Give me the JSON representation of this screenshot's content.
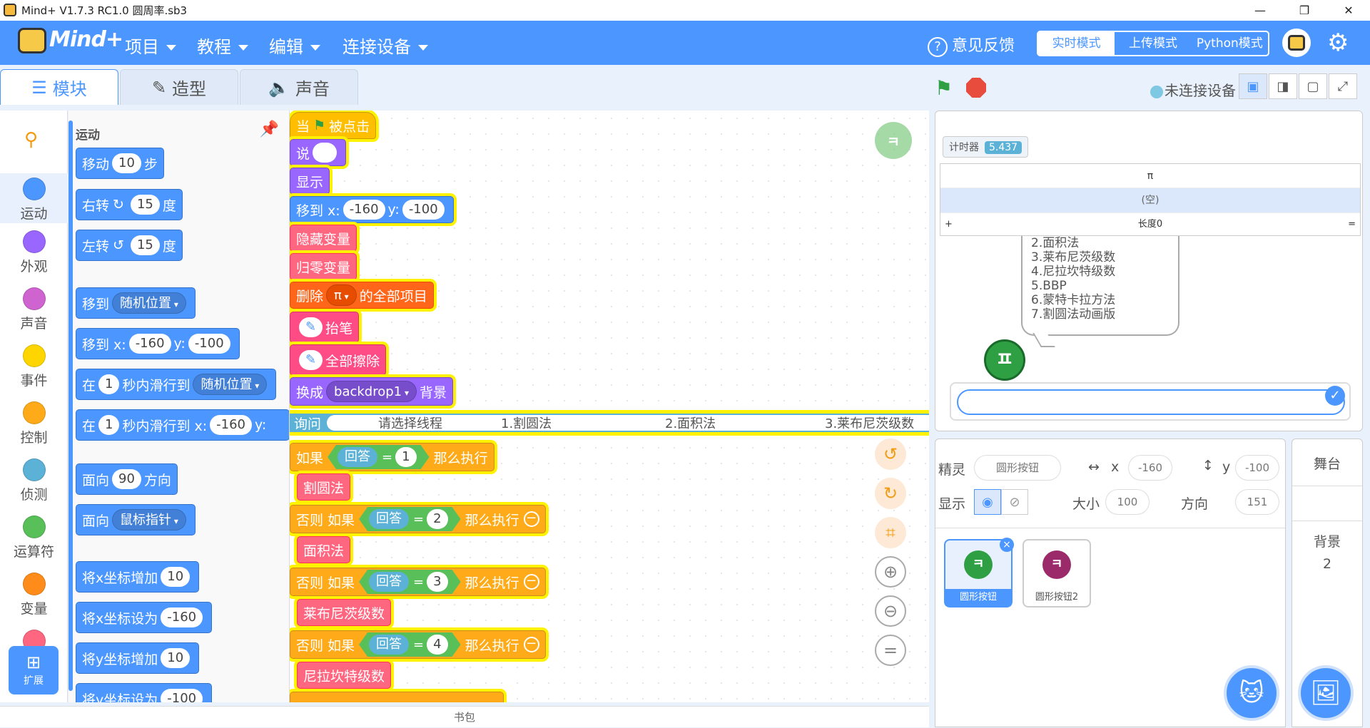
{
  "window": {
    "title": "Mind+ V1.7.3 RC1.0    圆周率.sb3",
    "min": "—",
    "max": "❐",
    "close": "✕"
  },
  "menubar": {
    "logo": "Mind+",
    "items": [
      "项目",
      "教程",
      "编辑",
      "连接设备"
    ],
    "feedback": "意见反馈",
    "modes": [
      "实时模式",
      "上传模式",
      "Python模式"
    ]
  },
  "tabs": [
    "模块",
    "造型",
    "声音"
  ],
  "categories": [
    {
      "label": "运动",
      "color": "#4c97ff"
    },
    {
      "label": "外观",
      "color": "#9966ff"
    },
    {
      "label": "声音",
      "color": "#cf63cf"
    },
    {
      "label": "事件",
      "color": "#ffd500"
    },
    {
      "label": "控制",
      "color": "#ffab19"
    },
    {
      "label": "侦测",
      "color": "#5cb1d6"
    },
    {
      "label": "运算符",
      "color": "#59c059"
    },
    {
      "label": "变量",
      "color": "#ff8c1a"
    }
  ],
  "extension": "扩展",
  "palette": {
    "heading": "运动",
    "move": {
      "a": "移动",
      "n": "10",
      "b": "步"
    },
    "turn_right": {
      "a": "右转",
      "n": "15",
      "b": "度"
    },
    "turn_left": {
      "a": "左转",
      "n": "15",
      "b": "度"
    },
    "goto": {
      "a": "移到",
      "d": "随机位置"
    },
    "goto_xy": {
      "a": "移到 x:",
      "x": "-160",
      "b": "y:",
      "y": "-100"
    },
    "glide": {
      "a": "在",
      "n": "1",
      "b": "秒内滑行到",
      "d": "随机位置"
    },
    "glide_xy": {
      "a": "在",
      "n": "1",
      "b": "秒内滑行到 x:",
      "x": "-160",
      "c": "y:"
    },
    "point_dir": {
      "a": "面向",
      "n": "90",
      "b": "方向"
    },
    "point_to": {
      "a": "面向",
      "d": "鼠标指针"
    },
    "change_x": {
      "a": "将x坐标增加",
      "n": "10"
    },
    "set_x": {
      "a": "将x坐标设为",
      "n": "-160"
    },
    "change_y": {
      "a": "将y坐标增加",
      "n": "10"
    },
    "set_y": {
      "a": "将y坐标设为",
      "n": "-100"
    }
  },
  "script": {
    "hat": {
      "a": "当",
      "b": "被点击"
    },
    "say": "说",
    "show": "显示",
    "goto_xy": {
      "a": "移到 x:",
      "x": "-160",
      "b": "y:",
      "y": "-100"
    },
    "hide_var": "隐藏变量",
    "reset_var": "归零变量",
    "delete_all": {
      "a": "删除",
      "d": "π",
      "b": "的全部项目"
    },
    "pen_up": "抬笔",
    "clear": "全部擦除",
    "backdrop": {
      "a": "换成",
      "d": "backdrop1",
      "b": "背景"
    },
    "ask": {
      "a": "询问",
      "prompt": "请选择线程",
      "o1": "1.割圆法",
      "o2": "2.面积法",
      "o3": "3.莱布尼茨级数"
    },
    "if1": {
      "a": "如果",
      "rep": "回答",
      "eq": "=",
      "n": "1",
      "b": "那么执行",
      "body": "割圆法"
    },
    "elif2": {
      "a": "否则 如果",
      "rep": "回答",
      "eq": "=",
      "n": "2",
      "b": "那么执行",
      "body": "面积法"
    },
    "elif3": {
      "a": "否则 如果",
      "rep": "回答",
      "eq": "=",
      "n": "3",
      "b": "那么执行",
      "body": "莱布尼茨级数"
    },
    "elif4": {
      "a": "否则 如果",
      "rep": "回答",
      "eq": "=",
      "n": "4",
      "b": "那么执行",
      "body": "尼拉坎特级数"
    }
  },
  "backpack": "书包",
  "stage_header": {
    "status": "未连接设备"
  },
  "stage": {
    "timer": {
      "label": "计时器",
      "value": "5.437"
    },
    "list": {
      "name": "π",
      "empty": "(空)",
      "add": "+",
      "length": "长度0",
      "eq": "="
    },
    "bubble_lines": [
      "2.面积法",
      "3.莱布尼茨级数",
      "4.尼拉坎特级数",
      "5.BBP",
      "6.蒙特卡拉方法",
      "7.割圆法动画版"
    ]
  },
  "sprite_info": {
    "sprite_label": "精灵",
    "sprite_name": "圆形按钮",
    "x_label": "x",
    "x": "-160",
    "y_label": "y",
    "y": "-100",
    "show_label": "显示",
    "size_label": "大小",
    "size": "100",
    "dir_label": "方向",
    "dir": "151"
  },
  "sprites": [
    "圆形按钮",
    "圆形按钮2"
  ],
  "stage_pane": {
    "title": "舞台",
    "bg_label": "背景",
    "bg_count": "2"
  }
}
